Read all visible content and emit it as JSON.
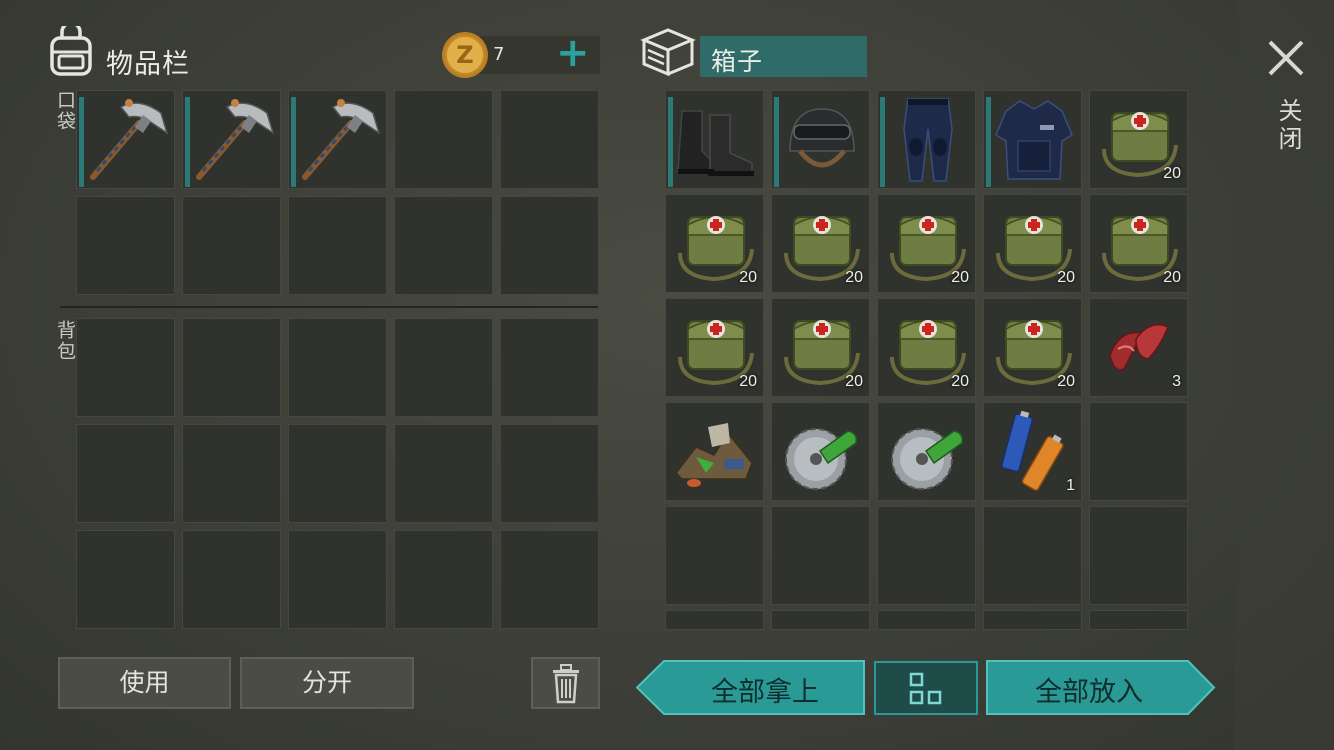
{
  "inventory": {
    "title": "物品栏",
    "pocket_label": "口袋",
    "backpack_label": "背包",
    "coins": "7",
    "add_symbol": "+",
    "pocket_items": [
      {
        "icon": "pickaxe-icon",
        "count": ""
      },
      {
        "icon": "pickaxe-icon",
        "count": ""
      },
      {
        "icon": "pickaxe-icon",
        "count": ""
      },
      {
        "icon": "",
        "count": ""
      },
      {
        "icon": "",
        "count": ""
      },
      {
        "icon": "",
        "count": ""
      },
      {
        "icon": "",
        "count": ""
      },
      {
        "icon": "",
        "count": ""
      },
      {
        "icon": "",
        "count": ""
      },
      {
        "icon": "",
        "count": ""
      }
    ],
    "use_label": "使用",
    "split_label": "分开"
  },
  "container": {
    "title": "箱子",
    "items": [
      {
        "icon": "boots-icon",
        "count": ""
      },
      {
        "icon": "helmet-icon",
        "count": ""
      },
      {
        "icon": "pants-icon",
        "count": ""
      },
      {
        "icon": "armor-vest-icon",
        "count": ""
      },
      {
        "icon": "medkit-bag-icon",
        "count": "20"
      },
      {
        "icon": "medkit-bag-icon",
        "count": "20"
      },
      {
        "icon": "medkit-bag-icon",
        "count": "20"
      },
      {
        "icon": "medkit-bag-icon",
        "count": "20"
      },
      {
        "icon": "medkit-bag-icon",
        "count": "20"
      },
      {
        "icon": "medkit-bag-icon",
        "count": "20"
      },
      {
        "icon": "medkit-bag-icon",
        "count": "20"
      },
      {
        "icon": "medkit-bag-icon",
        "count": "20"
      },
      {
        "icon": "medkit-bag-icon",
        "count": "20"
      },
      {
        "icon": "medkit-bag-icon",
        "count": "20"
      },
      {
        "icon": "raw-meat-icon",
        "count": "3"
      },
      {
        "icon": "scrap-pile-icon",
        "count": ""
      },
      {
        "icon": "saw-blade-icon",
        "count": ""
      },
      {
        "icon": "saw-blade-icon",
        "count": ""
      },
      {
        "icon": "batteries-icon",
        "count": "1"
      }
    ],
    "take_all_label": "全部拿上",
    "put_all_label": "全部放入"
  },
  "close_label": "关闭",
  "colors": {
    "accent": "#2a9a96",
    "slot_bar": "#2c7a78",
    "coin": "#d8a23a"
  }
}
